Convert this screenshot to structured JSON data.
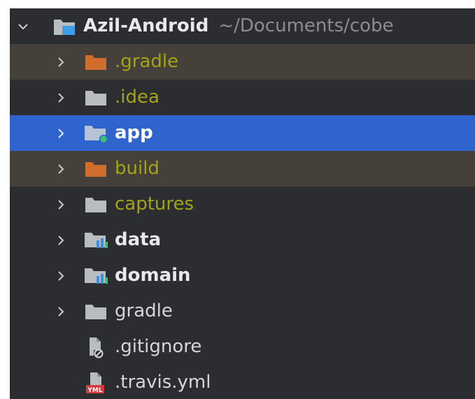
{
  "project_tree": {
    "root": {
      "name": "Azil-Android",
      "path": "~/Documents/cobe",
      "icon": "project-folder-icon",
      "expanded": true
    },
    "items": [
      {
        "label": ".gradle",
        "icon": "excluded-folder-icon",
        "state": "excluded"
      },
      {
        "label": ".idea",
        "icon": "folder-icon",
        "state": "ignored"
      },
      {
        "label": "app",
        "icon": "module-folder-icon",
        "state": "selected"
      },
      {
        "label": "build",
        "icon": "excluded-folder-icon",
        "state": "excluded"
      },
      {
        "label": "captures",
        "icon": "folder-icon",
        "state": "ignored"
      },
      {
        "label": "data",
        "icon": "library-module-icon",
        "state": "module"
      },
      {
        "label": "domain",
        "icon": "library-module-icon",
        "state": "module"
      },
      {
        "label": "gradle",
        "icon": "folder-icon",
        "state": "normal"
      },
      {
        "label": ".gitignore",
        "icon": "gitignore-file-icon",
        "state": "file"
      },
      {
        "label": ".travis.yml",
        "icon": "yaml-file-icon",
        "state": "file",
        "badge": "YML"
      }
    ]
  },
  "colors": {
    "background": "#2b2d30",
    "selection": "#2f64cf",
    "excluded_row": "#45403a",
    "excluded_text": "#a3a317",
    "excluded_folder": "#cf6d2c",
    "folder": "#b9bcc1",
    "module_badge": "#3ec177",
    "library_bars": "#3f8fd8",
    "yaml_badge": "#d03a3a"
  }
}
